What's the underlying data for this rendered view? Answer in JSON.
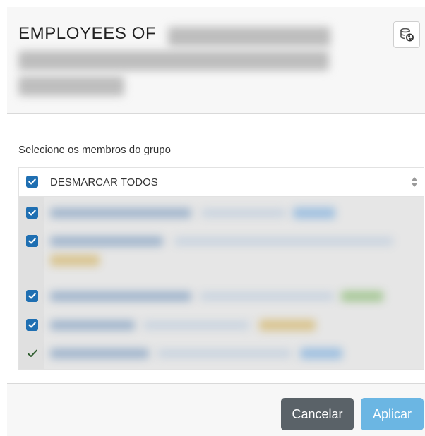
{
  "dialog": {
    "title": "EMPLOYEES OF"
  },
  "members": {
    "label": "Selecione os membros do grupo",
    "toggle_all_label": "DESMARCAR TODOS",
    "rows": [
      {
        "checked": true,
        "style": "checkbox"
      },
      {
        "checked": true,
        "style": "checkbox"
      },
      {
        "checked": true,
        "style": "checkbox"
      },
      {
        "checked": true,
        "style": "checkbox"
      },
      {
        "checked": true,
        "style": "checkmark"
      }
    ]
  },
  "footer": {
    "cancel_label": "Cancelar",
    "apply_label": "Aplicar"
  },
  "colors": {
    "checkbox": "#1f6fb2",
    "cancel_button": "#5a6268",
    "apply_button": "#6bb6e3"
  },
  "icons": {
    "refresh": "database-refresh-icon",
    "sort": "sort-icon",
    "check": "check-icon"
  }
}
